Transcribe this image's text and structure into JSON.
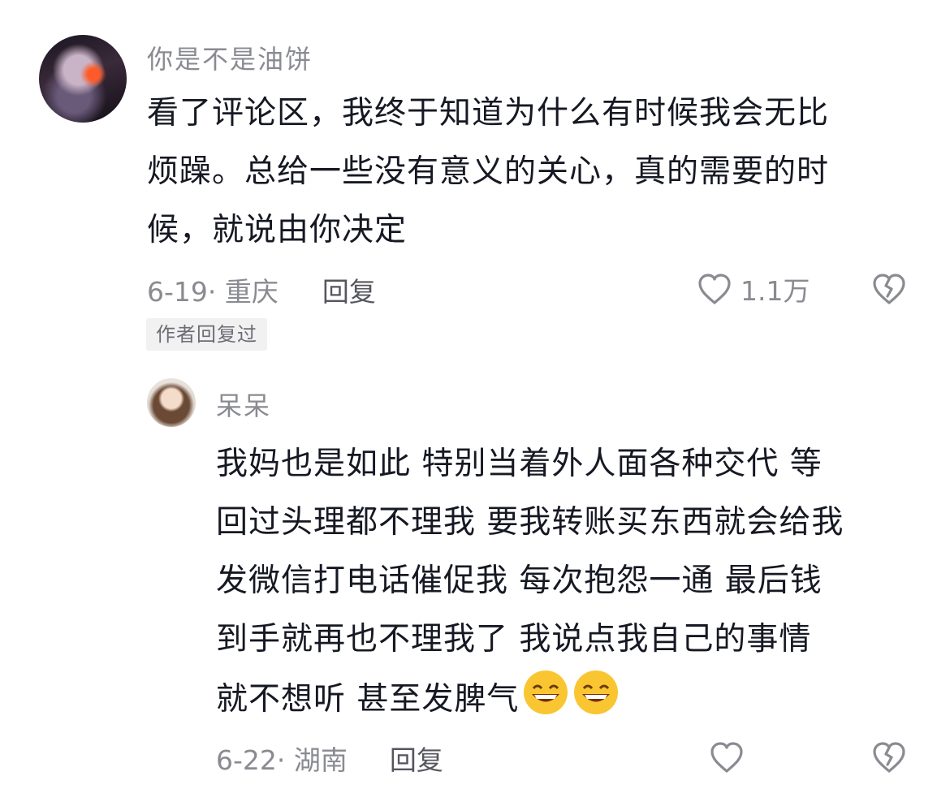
{
  "comment": {
    "username": "你是不是油饼",
    "text": "看了评论区，我终于知道为什么有时候我会无比\n烦躁。总给一些没有意义的关心，真的需要的时\n候，就说由你决定",
    "date_location": "6-19· 重庆",
    "reply_label": "回复",
    "like_count": "1.1万",
    "author_tag": "作者回复过"
  },
  "reply": {
    "username": "呆呆",
    "text": "我妈也是如此 特别当着外人面各种交代 等\n回过头理都不理我 要我转账买东西就会给我\n发微信打电话催促我 每次抱怨一通 最后钱\n到手就再也不理我了 我说点我自己的事情\n就不想听 甚至发脾气",
    "emojis": [
      "grin-emoji",
      "grin-emoji"
    ],
    "date_location": "6-22· 湖南",
    "reply_label": "回复"
  }
}
